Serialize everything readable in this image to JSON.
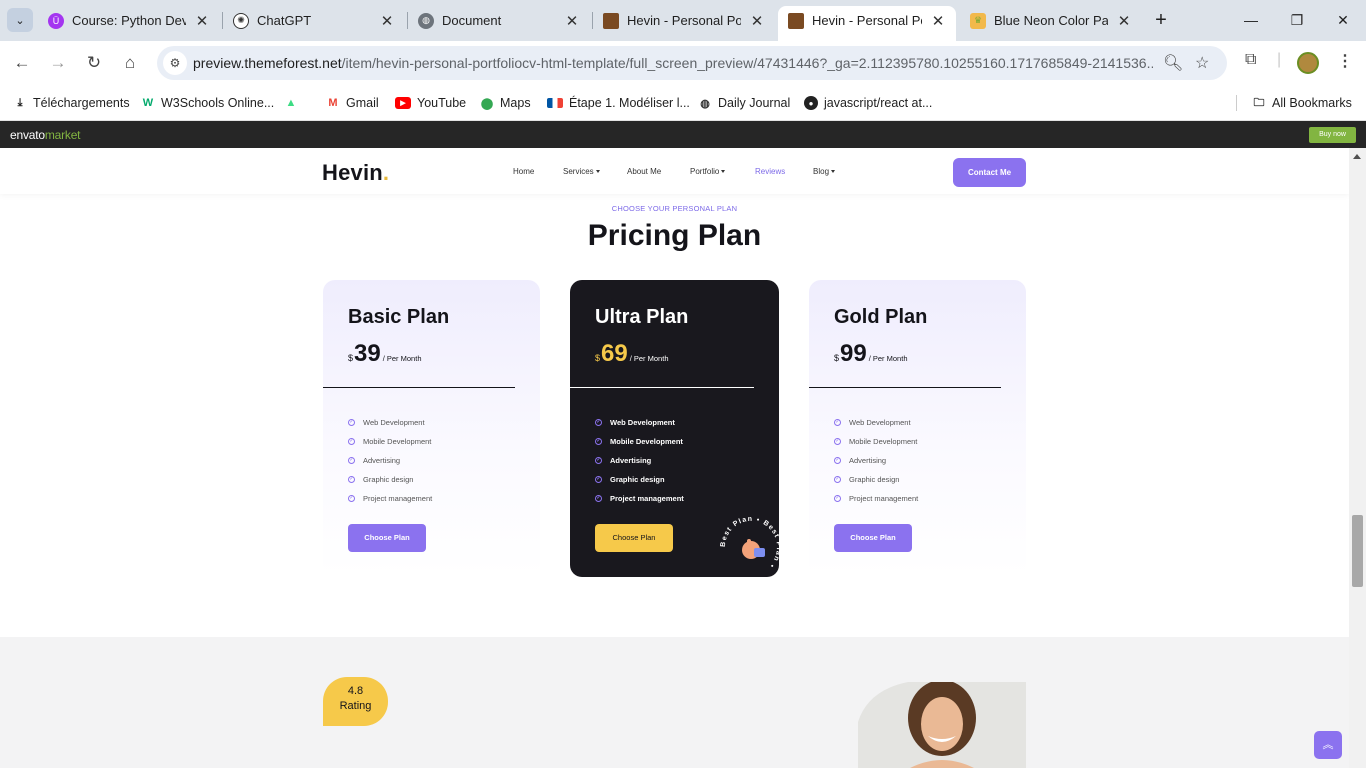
{
  "browser": {
    "tabs": [
      {
        "title": "Course: Python Devel",
        "favicon": "udemy-icon",
        "active": false
      },
      {
        "title": "ChatGPT",
        "favicon": "chatgpt-icon",
        "active": false
      },
      {
        "title": "Document",
        "favicon": "globe-icon",
        "active": false
      },
      {
        "title": "Hevin - Personal Portf",
        "favicon": "hevin-icon",
        "active": false
      },
      {
        "title": "Hevin - Personal Portf",
        "favicon": "hevin-icon",
        "active": true
      },
      {
        "title": "Blue Neon Color Pale",
        "favicon": "palette-icon",
        "active": false
      }
    ],
    "url_host": "preview.themeforest.net",
    "url_path": "/item/hevin-personal-portfoliocv-html-template/full_screen_preview/47431446?_ga=2.112395780.10255160.1717685849-2141536...",
    "bookmarks": [
      {
        "label": "Téléchargements",
        "icon": "download-icon"
      },
      {
        "label": "W3Schools Online...",
        "icon": "w3schools-icon"
      },
      {
        "label": "",
        "icon": "android-icon"
      },
      {
        "label": "Gmail",
        "icon": "gmail-icon"
      },
      {
        "label": "YouTube",
        "icon": "youtube-icon"
      },
      {
        "label": "Maps",
        "icon": "maps-icon"
      },
      {
        "label": "Étape 1. Modéliser l...",
        "icon": "flag-icon"
      },
      {
        "label": "Daily Journal",
        "icon": "globe-icon"
      },
      {
        "label": "javascript/react at...",
        "icon": "github-icon"
      }
    ],
    "all_bookmarks": "All Bookmarks"
  },
  "envato": {
    "logo_main": "envato",
    "logo_sub": "market",
    "buy_now": "Buy now"
  },
  "site": {
    "brand": "Hevin",
    "brand_dot": ".",
    "nav": [
      "Home",
      "Services",
      "About Me",
      "Portfolio",
      "Reviews",
      "Blog"
    ],
    "contact": "Contact Me",
    "eyebrow": "CHOOSE YOUR PERSONAL PLAN",
    "title": "Pricing Plan",
    "plans": [
      {
        "name": "Basic Plan",
        "currency": "$",
        "price": "39",
        "period": "/ Per Month",
        "features": [
          "Web Development",
          "Mobile Development",
          "Advertising",
          "Graphic design",
          "Project management"
        ],
        "button": "Choose Plan"
      },
      {
        "name": "Ultra Plan",
        "currency": "$",
        "price": "69",
        "period": "/ Per Month",
        "features": [
          "Web Development",
          "Mobile Development",
          "Advertising",
          "Graphic design",
          "Project management"
        ],
        "button": "Choose Plan",
        "badge": "Best Plan • Best Plan •"
      },
      {
        "name": "Gold Plan",
        "currency": "$",
        "price": "99",
        "period": "/ Per Month",
        "features": [
          "Web Development",
          "Mobile Development",
          "Advertising",
          "Graphic design",
          "Project management"
        ],
        "button": "Choose Plan"
      }
    ],
    "rating_value": "4.8",
    "rating_label": "Rating"
  },
  "colors": {
    "accent": "#8b72ef",
    "gold": "#f6c94a",
    "dark": "#19181e"
  }
}
